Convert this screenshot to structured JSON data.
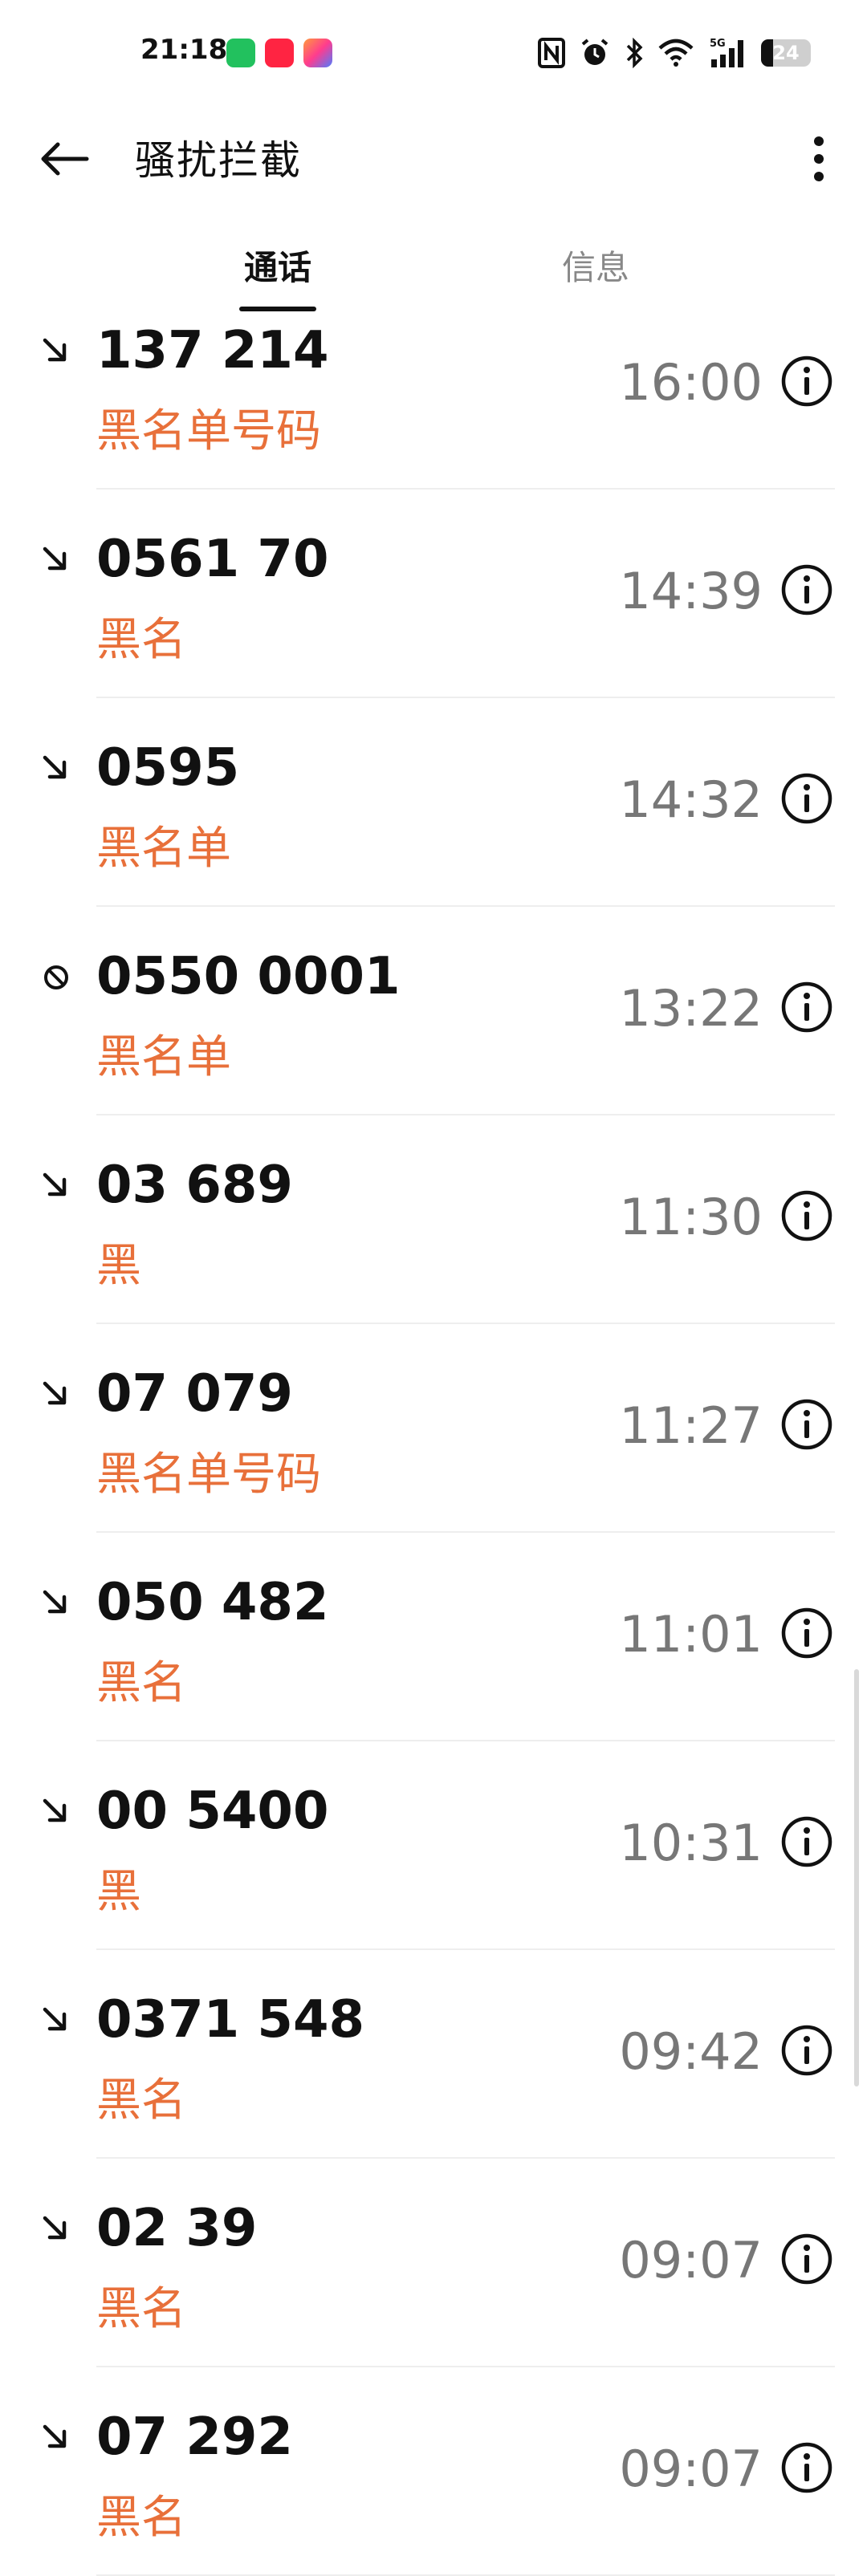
{
  "status_bar": {
    "time": "21:18",
    "battery_level": "24",
    "app_icons": [
      "wechat-icon",
      "redbook-icon",
      "photos-icon"
    ],
    "network_label": "5G"
  },
  "header": {
    "title": "骚扰拦截"
  },
  "tabs": [
    {
      "label": "通话",
      "active": true
    },
    {
      "label": "信息",
      "active": false
    }
  ],
  "calls": [
    {
      "number": "137 214",
      "label": "黑名单号码",
      "time": "16:00",
      "type": "incoming-blocked"
    },
    {
      "number": "0561 70",
      "label": "黑名",
      "time": "14:39",
      "type": "incoming-blocked"
    },
    {
      "number": "0595",
      "label": "黑名单",
      "time": "14:32",
      "type": "incoming-blocked"
    },
    {
      "number": "0550 0001",
      "label": "黑名单",
      "time": "13:22",
      "type": "rejected"
    },
    {
      "number": "03 689",
      "label": "黑",
      "time": "11:30",
      "type": "incoming-blocked"
    },
    {
      "number": "07 079",
      "label": "黑名单号码",
      "time": "11:27",
      "type": "incoming-blocked"
    },
    {
      "number": "050 482",
      "label": "黑名",
      "time": "11:01",
      "type": "incoming-blocked"
    },
    {
      "number": "00 5400",
      "label": "黑",
      "time": "10:31",
      "type": "incoming-blocked"
    },
    {
      "number": "0371 548",
      "label": "黑名",
      "time": "09:42",
      "type": "incoming-blocked"
    },
    {
      "number": "02 39",
      "label": "黑名",
      "time": "09:07",
      "type": "incoming-blocked"
    },
    {
      "number": "07 292",
      "label": "黑名",
      "time": "09:07",
      "type": "incoming-blocked"
    }
  ],
  "colors": {
    "accent_orange": "#e8703a",
    "time_gray": "#777777",
    "text_black": "#111111"
  }
}
